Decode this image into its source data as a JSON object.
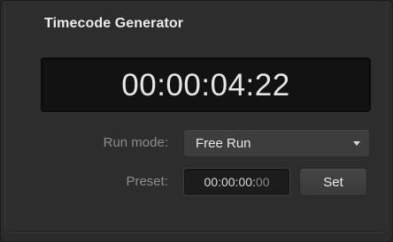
{
  "panel": {
    "title": "Timecode Generator"
  },
  "display": {
    "timecode": "00:00:04:22"
  },
  "run_mode": {
    "label": "Run mode:",
    "selected": "Free Run",
    "icon": "chevron-down-icon"
  },
  "preset": {
    "label": "Preset:",
    "value_main": "00:00:00:",
    "value_frames": "00",
    "set_label": "Set"
  }
}
